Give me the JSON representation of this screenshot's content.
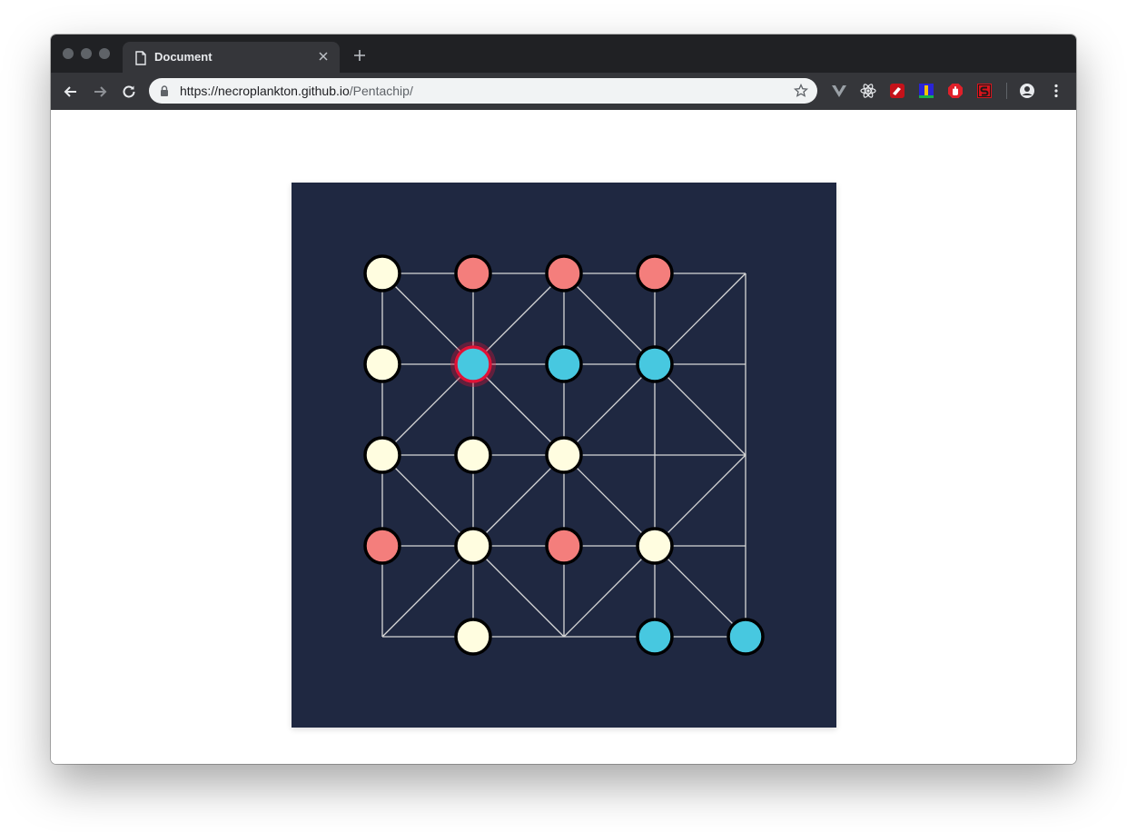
{
  "browser": {
    "tab_title": "Document",
    "url_host": "https://necroplankton.github.io",
    "url_path": "/Pentachip/"
  },
  "colors": {
    "board_bg": "#1f2841",
    "line": "#d8d8d8",
    "cream": "#fffde0",
    "red": "#f47e7c",
    "blue": "#47c8e0",
    "selected_ring": "#e01236"
  },
  "game": {
    "grid_size": 5,
    "nodes": [
      [
        0,
        0,
        "cream"
      ],
      [
        1,
        0,
        "red"
      ],
      [
        2,
        0,
        "red"
      ],
      [
        3,
        0,
        "red"
      ],
      [
        4,
        0,
        "empty"
      ],
      [
        0,
        1,
        "cream"
      ],
      [
        1,
        1,
        "blue-selected"
      ],
      [
        2,
        1,
        "blue"
      ],
      [
        3,
        1,
        "blue"
      ],
      [
        4,
        1,
        "empty"
      ],
      [
        0,
        2,
        "cream"
      ],
      [
        1,
        2,
        "cream"
      ],
      [
        2,
        2,
        "cream"
      ],
      [
        3,
        2,
        "empty"
      ],
      [
        4,
        2,
        "empty"
      ],
      [
        0,
        3,
        "red"
      ],
      [
        1,
        3,
        "cream"
      ],
      [
        2,
        3,
        "red"
      ],
      [
        3,
        3,
        "cream"
      ],
      [
        4,
        3,
        "empty"
      ],
      [
        0,
        4,
        "empty"
      ],
      [
        1,
        4,
        "cream"
      ],
      [
        2,
        4,
        "empty"
      ],
      [
        3,
        4,
        "blue"
      ],
      [
        4,
        4,
        "blue"
      ]
    ],
    "diagonals": [
      [
        [
          0,
          0
        ],
        [
          1,
          1
        ]
      ],
      [
        [
          1,
          1
        ],
        [
          2,
          2
        ]
      ],
      [
        [
          2,
          2
        ],
        [
          3,
          3
        ]
      ],
      [
        [
          3,
          3
        ],
        [
          4,
          4
        ]
      ],
      [
        [
          2,
          0
        ],
        [
          1,
          1
        ]
      ],
      [
        [
          1,
          1
        ],
        [
          0,
          2
        ]
      ],
      [
        [
          2,
          0
        ],
        [
          3,
          1
        ]
      ],
      [
        [
          3,
          1
        ],
        [
          4,
          2
        ]
      ],
      [
        [
          4,
          0
        ],
        [
          3,
          1
        ]
      ],
      [
        [
          3,
          1
        ],
        [
          2,
          2
        ]
      ],
      [
        [
          2,
          2
        ],
        [
          1,
          3
        ]
      ],
      [
        [
          1,
          3
        ],
        [
          0,
          4
        ]
      ],
      [
        [
          0,
          2
        ],
        [
          1,
          3
        ]
      ],
      [
        [
          1,
          3
        ],
        [
          2,
          4
        ]
      ],
      [
        [
          2,
          4
        ],
        [
          3,
          3
        ]
      ],
      [
        [
          3,
          3
        ],
        [
          4,
          2
        ]
      ]
    ]
  }
}
